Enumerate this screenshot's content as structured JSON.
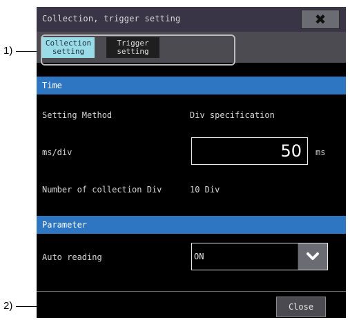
{
  "window": {
    "title": "Collection, trigger setting",
    "close_icon": "close-icon"
  },
  "tabs": [
    {
      "line1": "Collection",
      "line2": "setting",
      "active": true
    },
    {
      "line1": "Trigger",
      "line2": "setting",
      "active": false
    }
  ],
  "sections": {
    "time": {
      "header": "Time",
      "setting_method_label": "Setting Method",
      "setting_method_value": "Div specification",
      "ms_div_label": "ms/div",
      "ms_div_value": "50",
      "ms_div_unit": "ms",
      "collection_div_label": "Number of collection Div",
      "collection_div_value": "10 Div"
    },
    "parameter": {
      "header": "Parameter",
      "auto_reading_label": "Auto reading",
      "auto_reading_value": "ON"
    }
  },
  "footer": {
    "close_label": "Close"
  },
  "callouts": {
    "tabs_marker": "1)",
    "close_marker": "2)"
  },
  "colors": {
    "title_bar": "#3a3447",
    "section_header": "#2f76c2",
    "active_tab": "#9adbe8",
    "background": "#000000"
  }
}
